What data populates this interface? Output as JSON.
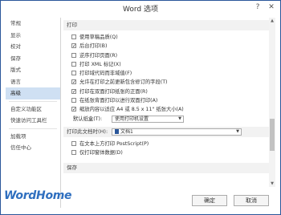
{
  "window": {
    "title": "Word 选项",
    "help_label": "?",
    "close_label": "✕"
  },
  "sidebar": {
    "items": [
      {
        "label": "常规"
      },
      {
        "label": "显示"
      },
      {
        "label": "校对"
      },
      {
        "label": "保存"
      },
      {
        "label": "版式"
      },
      {
        "label": "语言"
      },
      {
        "label": "高级",
        "active": true
      },
      {
        "label": "自定义功能区"
      },
      {
        "label": "快速访问工具栏"
      },
      {
        "label": "加载项"
      },
      {
        "label": "信任中心"
      }
    ]
  },
  "print_section": {
    "heading": "打印",
    "options": [
      {
        "label": "使用草稿品质(Q)",
        "checked": false
      },
      {
        "label": "后台打印(B)",
        "checked": true
      },
      {
        "label": "逆序打印页面(R)",
        "checked": false
      },
      {
        "label": "打印 XML 标记(X)",
        "checked": false
      },
      {
        "label": "打印域代码而非域值(F)",
        "checked": false
      },
      {
        "label": "允许在打印之前更新包含修订的字段(T)",
        "checked": true
      },
      {
        "label": "打印在双面打印纸张的正面(R)",
        "checked": true
      },
      {
        "label": "在纸张背面打印以进行双面打印(A)",
        "checked": false
      },
      {
        "label": "缩放内容以适应 A4 或 8.5 x 11\" 纸张大小(A)",
        "checked": true
      }
    ],
    "default_tray_label": "默认纸盒(T):",
    "default_tray_value": "使用打印机设置"
  },
  "document_section": {
    "label": "打印此文档时(H):",
    "document_name": "文档1",
    "options": [
      {
        "label": "在文本上方打印 PostScript(P)",
        "checked": false
      },
      {
        "label": "仅打印窗体数据(D)",
        "checked": false
      }
    ]
  },
  "save_section": {
    "heading": "保存"
  },
  "buttons": {
    "ok": "确定",
    "cancel": "取消"
  },
  "watermark": "WordHome"
}
